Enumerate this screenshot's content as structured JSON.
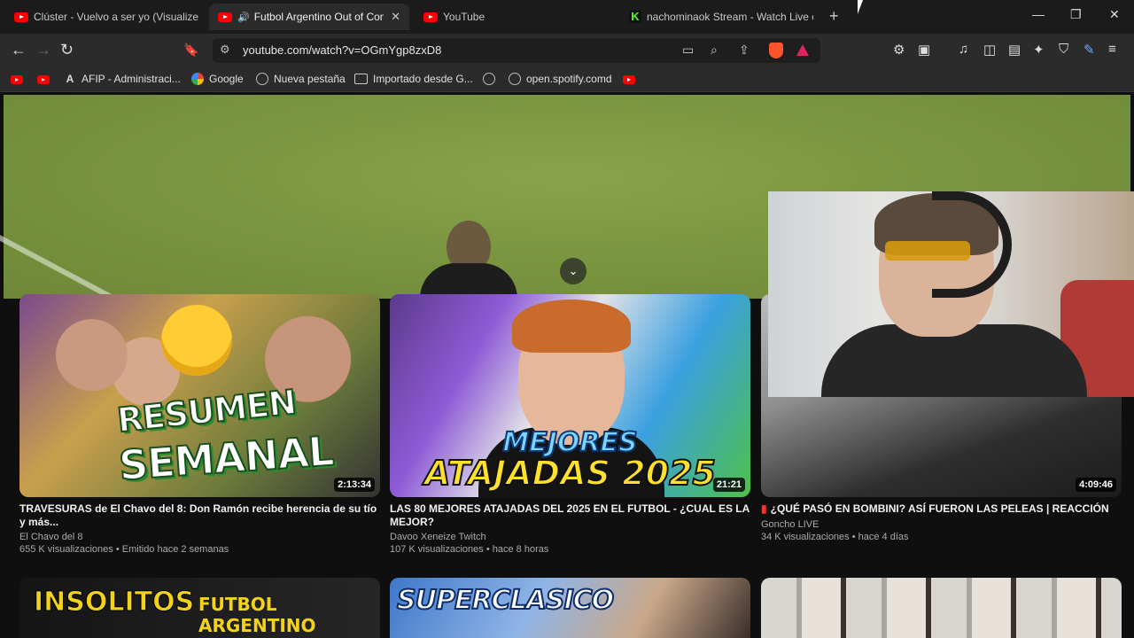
{
  "tabs": [
    {
      "label": "Clúster - Vuelvo a ser yo (Visualizer C",
      "icon": "youtube-icon",
      "active": false
    },
    {
      "label": "Futbol Argentino Out of Cont",
      "icon": "youtube-icon",
      "active": true,
      "audio": "🔊",
      "close": "✕"
    },
    {
      "label": "YouTube",
      "icon": "youtube-icon",
      "active": false
    },
    {
      "label": "nachominaok Stream - Watch Live on",
      "icon": "kick-icon",
      "active": false
    }
  ],
  "kick_letter": "K",
  "new_tab": "+",
  "window_controls": {
    "minimize": "—",
    "maximize": "❐",
    "close": "✕"
  },
  "nav": {
    "back": "←",
    "forward": "→",
    "reload": "↻",
    "bookmark": "🔖"
  },
  "address": {
    "url": "youtube.com/watch?v=OGmYgp8zxD8",
    "site_settings": "⚙"
  },
  "omnibox_icons": {
    "cast": "▭",
    "zoom": "⌕",
    "share": "⇪"
  },
  "toolbar_icons": {
    "extensions": "⚙",
    "tab_search": "▣",
    "media": "♫",
    "sidebar": "◫",
    "wallet": "▤",
    "leo": "✦",
    "vpn": "⛉",
    "edit": "✎",
    "menu": "≡"
  },
  "bookmarks": [
    {
      "label": "",
      "icon": "youtube-icon"
    },
    {
      "label": "",
      "icon": "youtube-icon"
    },
    {
      "label": "AFIP - Administraci...",
      "icon": "afip-icon",
      "glyph": "A"
    },
    {
      "label": "Google",
      "icon": "google-icon"
    },
    {
      "label": "Nueva pestaña",
      "icon": "globe-icon"
    },
    {
      "label": "Importado desde G...",
      "icon": "folder-icon"
    },
    {
      "label": "",
      "icon": "globe-icon"
    },
    {
      "label": "open.spotify.comd",
      "icon": "globe-icon"
    },
    {
      "label": "",
      "icon": "youtube-icon"
    }
  ],
  "player": {
    "collapse": "⌄"
  },
  "videos": [
    {
      "thumb_text": [
        "RESUMEN",
        "SEMANAL"
      ],
      "duration": "2:13:34",
      "title": "TRAVESURAS de El Chavo del 8: Don Ramón recibe herencia de su tío y más...",
      "channel": "El Chavo del 8",
      "meta": "655 K visualizaciones • Emitido hace 2 semanas"
    },
    {
      "thumb_text": [
        "MEJORES",
        "ATAJADAS 2025"
      ],
      "duration": "21:21",
      "title": "LAS 80 MEJORES ATAJADAS DEL 2025 EN EL FUTBOL - ¿CUAL ES LA MEJOR?",
      "channel": "Davoo Xeneize Twitch",
      "meta": "107 K visualizaciones • hace 8 horas"
    },
    {
      "thumb_text": [],
      "duration": "4:09:46",
      "title": "¿QUÉ PASÓ EN BOMBINI? ASÍ FUERON LAS PELEAS | REACCIÓN",
      "channel": "Goncho LIVE",
      "meta": "34 K visualizaciones • hace 4 días",
      "title_prefix": "▮"
    }
  ],
  "row2": {
    "a": [
      "INSOLITOS",
      "FUTBOL ARGENTINO"
    ],
    "b": "SUPERCLASICO"
  },
  "colors": {
    "accent": "#ff0000",
    "bg": "#0f0f0f",
    "thumb_yellow": "#f3d21b",
    "thumb_green": "#2a8c2e"
  }
}
